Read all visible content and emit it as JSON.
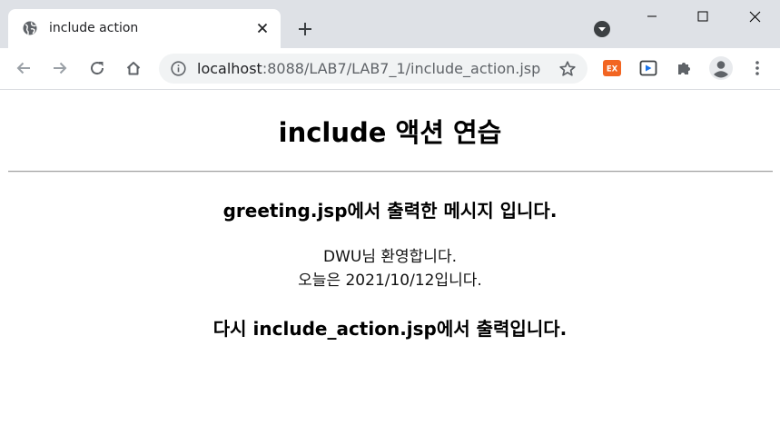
{
  "browser": {
    "tab": {
      "title": "include action",
      "favicon": "globe-icon"
    },
    "address_bar": {
      "host": "localhost",
      "path": ":8088/LAB7/LAB7_1/include_action.jsp"
    },
    "extensions": {
      "ex_label": "EX"
    },
    "colors": {
      "tabstrip": "#dee1e6",
      "omnibox": "#f1f3f4",
      "ex_badge": "#f26522"
    }
  },
  "page": {
    "heading": "include 액션 연습",
    "greeting_heading": "greeting.jsp에서 출력한 메시지 입니다.",
    "welcome_line": "DWU님 환영합니다.",
    "date_line": "오늘은 2021/10/12입니다.",
    "footer_heading": "다시 include_action.jsp에서 출력입니다."
  }
}
